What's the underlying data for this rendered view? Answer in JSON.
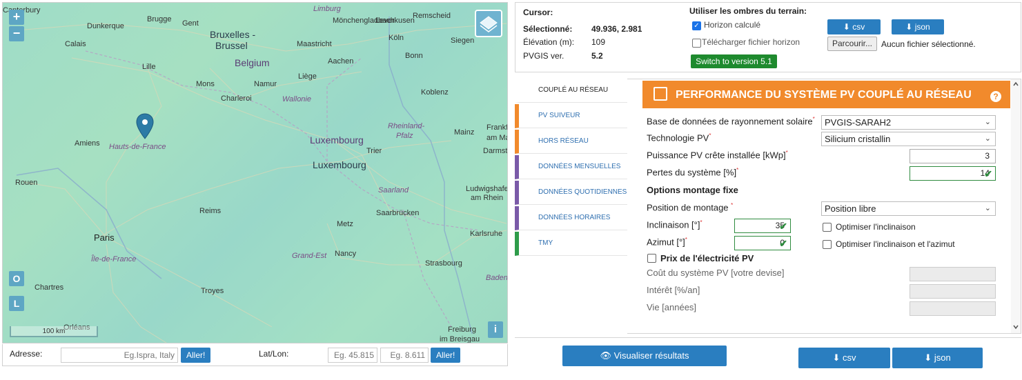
{
  "map": {
    "cities": [
      {
        "name": "Canterbury"
      },
      {
        "name": "Dunkerque"
      },
      {
        "name": "Calais"
      },
      {
        "name": "Brugge"
      },
      {
        "name": "Gent"
      },
      {
        "name": "Bruxelles -"
      },
      {
        "name": "Brussel"
      },
      {
        "name": "Lille"
      },
      {
        "name": "Mons"
      },
      {
        "name": "Charleroi"
      },
      {
        "name": "Namur"
      },
      {
        "name": "Liège"
      },
      {
        "name": "Maastricht"
      },
      {
        "name": "Aachen"
      },
      {
        "name": "Köln"
      },
      {
        "name": "Bonn"
      },
      {
        "name": "Mönchengladbach"
      },
      {
        "name": "Leverkusen"
      },
      {
        "name": "Remscheid"
      },
      {
        "name": "Siegen"
      },
      {
        "name": "Koblenz"
      },
      {
        "name": "Amiens"
      },
      {
        "name": "Luxembourg"
      },
      {
        "name": "Trier"
      },
      {
        "name": "Mainz"
      },
      {
        "name": "Darmsta"
      },
      {
        "name": "Frankf"
      },
      {
        "name": "am Main"
      },
      {
        "name": "Ludwigshafen"
      },
      {
        "name": "am Rhein"
      },
      {
        "name": "Rouen"
      },
      {
        "name": "Reims"
      },
      {
        "name": "Saarbrücken"
      },
      {
        "name": "Metz"
      },
      {
        "name": "Karlsruhe"
      },
      {
        "name": "Paris"
      },
      {
        "name": "Nancy"
      },
      {
        "name": "Strasbourg"
      },
      {
        "name": "Chartres"
      },
      {
        "name": "Troyes"
      },
      {
        "name": "Orléans"
      },
      {
        "name": "Freiburg"
      },
      {
        "name": "im Breisgau"
      }
    ],
    "regions": [
      "Limburg",
      "Wallonie",
      "Rheinland-",
      "Pfalz",
      "Hauts-de-France",
      "Saarland",
      "Île-de-France",
      "Grand-Est",
      "Baden"
    ],
    "countries": [
      "Belgium",
      "Luxembourg"
    ],
    "scale_label": "100 km",
    "zoom_in": "+",
    "zoom_out": "−",
    "btn_o": "O",
    "btn_l": "L",
    "info": "i"
  },
  "address_bar": {
    "address_label": "Adresse:",
    "address_placeholder": "Eg.Ispra, Italy",
    "go_label": "Aller!",
    "latlon_label": "Lat/Lon:",
    "lat_placeholder": "Eg. 45.815",
    "lon_placeholder": "Eg. 8.611",
    "go_label_2": "Aller!"
  },
  "top_panel": {
    "cursor_label": "Cursor:",
    "selected_label": "Sélectionné:",
    "selected_value": "49.936, 2.981",
    "elevation_label": "Élévation (m):",
    "elevation_value": "109",
    "pvgis_label": "PVGIS ver.",
    "pvgis_value": "5.2",
    "terrain_title": "Utiliser les ombres du terrain:",
    "horizon_calc": "Horizon calculé",
    "horizon_upload": "Télécharger fichier horizon",
    "switch_version": "Switch to version 5.1",
    "csv_label": "csv",
    "json_label": "json",
    "browse_label": "Parcourir...",
    "no_file": "Aucun fichier sélectionné."
  },
  "tabs": [
    {
      "label": "COUPLÉ AU RÉSEAU",
      "color": "#ffffff"
    },
    {
      "label": "PV SUIVEUR",
      "color": "#f18a2c"
    },
    {
      "label": "HORS RÉSEAU",
      "color": "#f18a2c"
    },
    {
      "label": "DONNÉES MENSUELLES",
      "color": "#7a5aa8"
    },
    {
      "label": "DONNÉES QUOTIDIENNES",
      "color": "#7a5aa8"
    },
    {
      "label": "DONNÉES HORAIRES",
      "color": "#7a5aa8"
    },
    {
      "label": "TMY",
      "color": "#2e9c4a"
    }
  ],
  "form": {
    "title": "PERFORMANCE DU SYSTÈME PV COUPLÉ AU RÉSEAU",
    "help": "?",
    "radiation_db_label": "Base de données de rayonnement solaire",
    "radiation_db_value": "PVGIS-SARAH2",
    "pv_tech_label": "Technologie PV",
    "pv_tech_value": "Silicium cristallin",
    "peak_power_label": "Puissance PV crête installée [kWp]",
    "peak_power_value": "3",
    "losses_label": "Pertes du système [%]",
    "losses_value": "14",
    "mount_options_title": "Options montage fixe",
    "mount_position_label": "Position de montage",
    "mount_position_value": "Position libre",
    "slope_label": "Inclinaison [°]",
    "slope_value": "35",
    "azimuth_label": "Azimut [°]",
    "azimuth_value": "0",
    "optimize_slope": "Optimiser l'inclinaison",
    "optimize_both": "Optimiser l'inclinaison et l'azimut",
    "price_title": "Prix de l'électricité PV",
    "system_cost_label": "Coût du système PV [votre devise]",
    "interest_label": "Intérêt [%/an]",
    "lifetime_label": "Vie [années]",
    "required_mark": "*"
  },
  "bottom": {
    "visualize_label": "Visualiser résultats",
    "csv_label": "csv",
    "json_label": "json"
  },
  "colors": {
    "accent_blue": "#2a7ec0",
    "header_orange": "#f18a2c",
    "switch_green": "#1e8a2e",
    "marker_blue": "#2d7ba6"
  }
}
